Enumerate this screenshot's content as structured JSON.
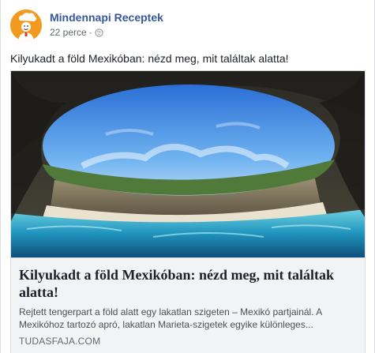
{
  "post": {
    "page_name": "Mindennapi Receptek",
    "time": "22 perce",
    "separator": "·",
    "audience_icon": "globe-icon",
    "text": "Kilyukadt a föld Mexikóban: nézd meg, mit találtak alatta!"
  },
  "link": {
    "title": "Kilyukadt a föld Mexikóban: nézd meg, mit találtak alatta!",
    "description": "Rejtett tengerpart a föld alatt egy lakatlan szigeten – Mexikó partjainál. A Mexikóhoz tartozó apró, lakatlan Marieta-szigetek egyike különleges...",
    "domain": "TUDASFAJA.COM"
  },
  "colors": {
    "page_name": "#365899",
    "avatar_bg": "#f29a1f",
    "card_bg": "#f2f3f5",
    "sky": "#3d8fe0",
    "water": "#2aa7c9"
  }
}
